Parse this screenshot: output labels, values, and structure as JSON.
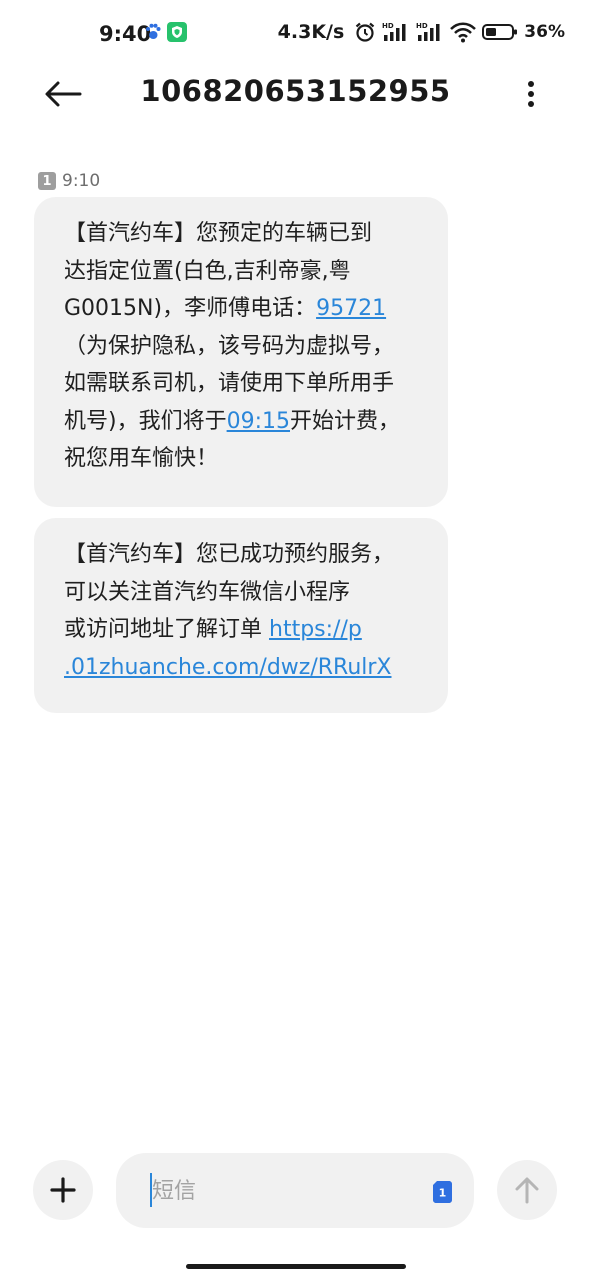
{
  "status_bar": {
    "time": "9:40",
    "net_speed": "4.3K/s",
    "battery_percent": "36%",
    "icons": [
      "paw-icon",
      "shield-app-icon",
      "alarm-icon",
      "signal-hd-icon",
      "signal-hd-icon",
      "wifi-icon",
      "battery-icon"
    ]
  },
  "header": {
    "title": "106820653152955",
    "back_icon": "arrow-left-icon",
    "more_icon": "more-vertical-icon"
  },
  "messages": {
    "sim_slot": "1",
    "timestamp": "9:10",
    "msg1": {
      "l1": "【首汽约车】您预定的车辆已到",
      "l2": "达指定位置(白色,吉利帝豪,粤",
      "l3_pre": "G0015N)，李师傅电话：",
      "l3_link": "95721",
      "l4": "（为保护隐私，该号码为虚拟号，",
      "l5": "如需联系司机，请使用下单所用手",
      "l6_pre": "机号)，我们将于",
      "l6_link": "09:15",
      "l6_post": "开始计费，",
      "l7": "祝您用车愉快！"
    },
    "msg2": {
      "l1": "【首汽约车】您已成功预约服务，",
      "l2": "可以关注首汽约车微信小程序",
      "l3_pre": "或访问地址了解订单 ",
      "l3_link": "https://p",
      "l4_link": ".01zhuanche.com/dwz/RRulrX"
    }
  },
  "composer": {
    "placeholder": "短信",
    "sim_badge": "1",
    "plus_icon": "plus-icon",
    "send_icon": "arrow-up-icon"
  },
  "colors": {
    "bubble_bg": "#f1f1f1",
    "link": "#2a86d9",
    "text": "#1f1f1f"
  }
}
